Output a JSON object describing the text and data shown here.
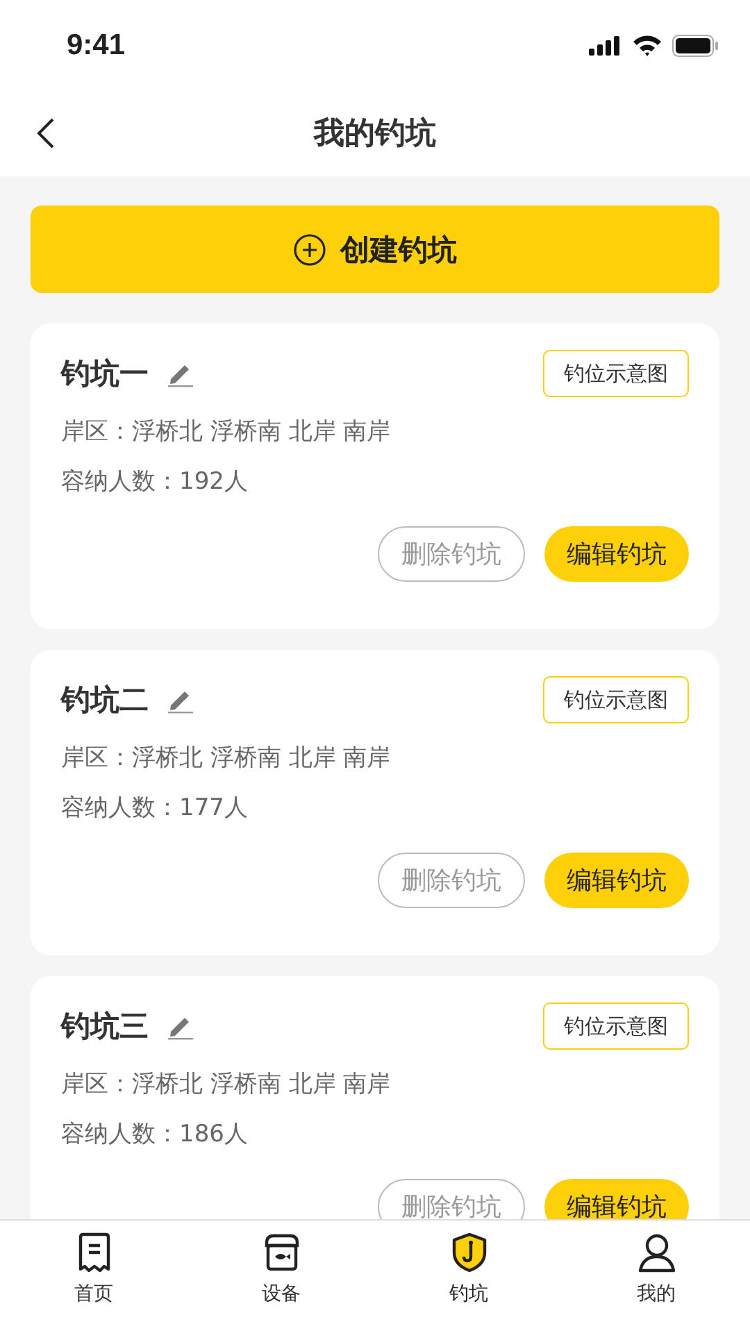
{
  "status_bar": {
    "time": "9:41"
  },
  "nav": {
    "title": "我的钓坑"
  },
  "create_button": {
    "label": "创建钓坑"
  },
  "pits": [
    {
      "name": "钓坑一",
      "map_button": "钓位示意图",
      "zones": "岸区：浮桥北 浮桥南 北岸 南岸",
      "capacity": "容纳人数：192人",
      "delete_button": "删除钓坑",
      "edit_button": "编辑钓坑"
    },
    {
      "name": "钓坑二",
      "map_button": "钓位示意图",
      "zones": "岸区：浮桥北 浮桥南 北岸 南岸",
      "capacity": "容纳人数：177人",
      "delete_button": "删除钓坑",
      "edit_button": "编辑钓坑"
    },
    {
      "name": "钓坑三",
      "map_button": "钓位示意图",
      "zones": "岸区：浮桥北 浮桥南 北岸 南岸",
      "capacity": "容纳人数：186人",
      "delete_button": "删除钓坑",
      "edit_button": "编辑钓坑"
    }
  ],
  "tab_bar": [
    {
      "kind": "home",
      "label": "首页",
      "selected": false
    },
    {
      "kind": "device",
      "label": "设备",
      "selected": false
    },
    {
      "kind": "pit",
      "label": "钓坑",
      "selected": true
    },
    {
      "kind": "mine",
      "label": "我的",
      "selected": false
    }
  ]
}
